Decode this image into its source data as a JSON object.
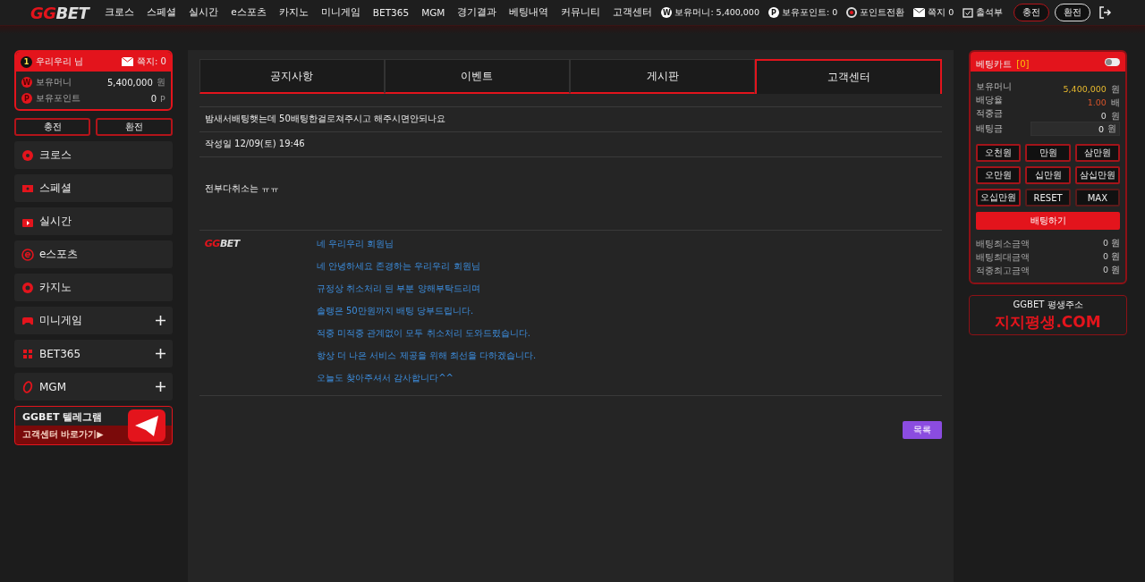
{
  "header": {
    "logo": {
      "accent": "GG",
      "rest": "BET"
    },
    "nav": [
      "크로스",
      "스페셜",
      "실시간",
      "e스포츠",
      "카지노",
      "미니게임",
      "BET365",
      "MGM",
      "경기결과",
      "베팅내역",
      "커뮤니티",
      "고객센터"
    ],
    "money": {
      "badge": "W",
      "text": "보유머니: 5,400,000"
    },
    "points": {
      "badge": "P",
      "text": "보유포인트: 0"
    },
    "convert": "포인트전환",
    "messages": "쪽지 0",
    "attendance": "출석부",
    "buttons": [
      "충전",
      "환전"
    ]
  },
  "user_card": {
    "level": "1",
    "name": "우리우리 님",
    "messages": "쪽지: 0",
    "rows": [
      {
        "badge": "W",
        "label": "보유머니",
        "value": "5,400,000",
        "unit": "원"
      },
      {
        "badge": "P",
        "label": "보유포인트",
        "value": "0",
        "unit": "P"
      }
    ]
  },
  "user_buttons": [
    "충전",
    "환전"
  ],
  "sidebar": {
    "items": [
      {
        "label": "크로스",
        "expandable": false
      },
      {
        "label": "스페셜",
        "expandable": false
      },
      {
        "label": "실시간",
        "expandable": false
      },
      {
        "label": "e스포츠",
        "expandable": false
      },
      {
        "label": "카지노",
        "expandable": false
      },
      {
        "label": "미니게임",
        "expandable": true
      },
      {
        "label": "BET365",
        "expandable": true
      },
      {
        "label": "MGM",
        "expandable": true
      }
    ]
  },
  "telegram_banner": {
    "title": "GGBET 텔레그램",
    "subtitle": "고객센터 바로가기▶"
  },
  "tabs": [
    {
      "label": "공지사항",
      "selected": false
    },
    {
      "label": "이벤트",
      "selected": false
    },
    {
      "label": "게시판",
      "selected": false
    },
    {
      "label": "고객센터",
      "selected": true
    }
  ],
  "post": {
    "title": "밤새서배팅햇는데 50배팅한걸로쳐주시고 해주시면안되나요",
    "date": "작성일 12/09(토) 19:46",
    "body": "전부다취소는 ㅠㅠ",
    "reply": {
      "logo": {
        "accent": "GG",
        "rest": "BET"
      },
      "lines": [
        "네 우리우리 회원님",
        "네 안녕하세요 존경하는 우리우리 회원님",
        "규정상 취소처리 된 부분 양해부탁드리며",
        "솔랭은 50만원까지 배팅 당부드립니다.",
        "적중 미적중 관계없이 모두 취소처리 도와드렸습니다.",
        "항상 더 나은 서비스 제공을 위해 최선을 다하겠습니다.",
        "오늘도 찾아주셔서 감사합니다^^"
      ]
    },
    "list_button": "목록"
  },
  "bet_cart": {
    "title": "베팅카트",
    "count": "[0]",
    "on": false,
    "rows": [
      {
        "label": "보유머니",
        "value": "5,400,000",
        "unit": "원"
      },
      {
        "label": "배당율",
        "value": "1.00",
        "unit": "배"
      },
      {
        "label": "적중금",
        "value": "0",
        "unit": "원"
      }
    ],
    "stake": {
      "label": "배팅금",
      "value": "0",
      "unit": "원"
    },
    "amounts": [
      {
        "label": "오천원",
        "kind": "amount"
      },
      {
        "label": "만원",
        "kind": "amount"
      },
      {
        "label": "삼만원",
        "kind": "amount"
      },
      {
        "label": "오만원",
        "kind": "amount"
      },
      {
        "label": "십만원",
        "kind": "amount"
      },
      {
        "label": "삼십만원",
        "kind": "amount"
      },
      {
        "label": "오십만원",
        "kind": "amount"
      },
      {
        "label": "RESET",
        "kind": "tool"
      },
      {
        "label": "MAX",
        "kind": "tool"
      }
    ],
    "bet_button": "배팅하기",
    "limits": [
      {
        "label": "배팅최소금액",
        "value": "0 원"
      },
      {
        "label": "배팅최대금액",
        "value": "0 원"
      },
      {
        "label": "적중최고금액",
        "value": "0 원"
      }
    ]
  },
  "address_box": {
    "caption": "GGBET 평생주소",
    "address": "지지평생.COM"
  }
}
